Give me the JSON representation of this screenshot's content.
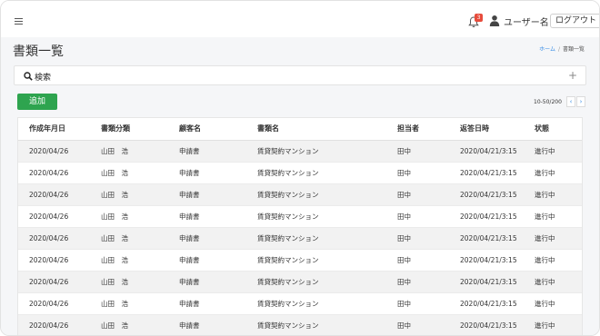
{
  "header": {
    "menu_icon": "hamburger-icon",
    "notification_icon": "bell-icon",
    "notification_count": "3",
    "user_icon": "user-icon",
    "user_name": "ユーザー名",
    "logout_label": "ログアウト"
  },
  "page": {
    "title": "書類一覧",
    "breadcrumb": {
      "home": "ホーム",
      "separator": "/",
      "current": "書類一覧"
    }
  },
  "search": {
    "icon": "search-icon",
    "label": "検索",
    "expand_icon": "plus-icon",
    "expand_symbol": "+"
  },
  "toolbar": {
    "add_label": "追加",
    "paging_info": "10-50/200",
    "prev_symbol": "‹",
    "next_symbol": "›"
  },
  "table": {
    "columns": [
      "作成年月日",
      "書類分類",
      "顧客名",
      "書類名",
      "担当者",
      "返答日時",
      "状態"
    ],
    "rows": [
      [
        "2020/04/26",
        "山田　浩",
        "申請書",
        "賃貸契約マンション",
        "田中",
        "2020/04/21/3:15",
        "進行中"
      ],
      [
        "2020/04/26",
        "山田　浩",
        "申請書",
        "賃貸契約マンション",
        "田中",
        "2020/04/21/3:15",
        "進行中"
      ],
      [
        "2020/04/26",
        "山田　浩",
        "申請書",
        "賃貸契約マンション",
        "田中",
        "2020/04/21/3:15",
        "進行中"
      ],
      [
        "2020/04/26",
        "山田　浩",
        "申請書",
        "賃貸契約マンション",
        "田中",
        "2020/04/21/3:15",
        "進行中"
      ],
      [
        "2020/04/26",
        "山田　浩",
        "申請書",
        "賃貸契約マンション",
        "田中",
        "2020/04/21/3:15",
        "進行中"
      ],
      [
        "2020/04/26",
        "山田　浩",
        "申請書",
        "賃貸契約マンション",
        "田中",
        "2020/04/21/3:15",
        "進行中"
      ],
      [
        "2020/04/26",
        "山田　浩",
        "申請書",
        "賃貸契約マンション",
        "田中",
        "2020/04/21/3:15",
        "進行中"
      ],
      [
        "2020/04/26",
        "山田　浩",
        "申請書",
        "賃貸契約マンション",
        "田中",
        "2020/04/21/3:15",
        "進行中"
      ],
      [
        "2020/04/26",
        "山田　浩",
        "申請書",
        "賃貸契約マンション",
        "田中",
        "2020/04/21/3:15",
        "進行中"
      ]
    ]
  },
  "colors": {
    "accent_green": "#2ea44f",
    "badge_red": "#e74c3c",
    "link_blue": "#3a8ee6",
    "row_stripe": "#f2f2f2",
    "main_bg": "#f5f6f8"
  }
}
